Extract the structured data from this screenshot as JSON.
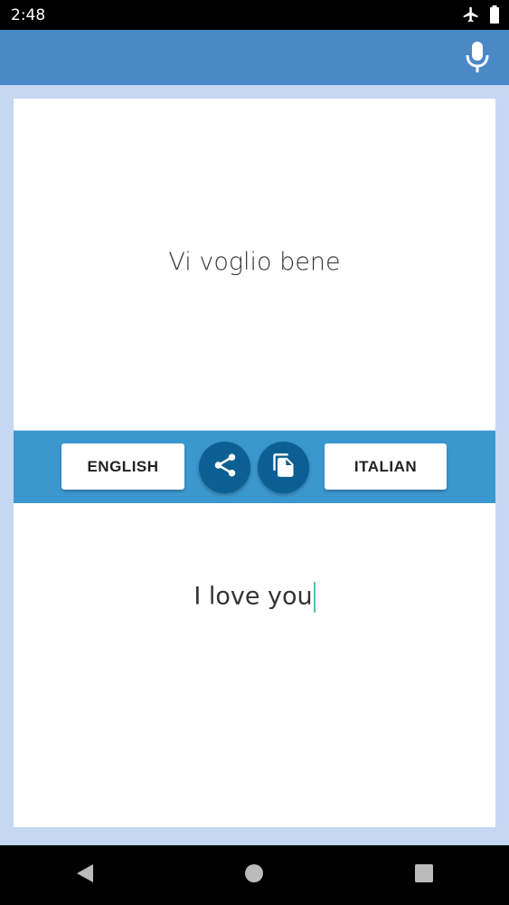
{
  "status_bar": {
    "time": "2:48",
    "icons": [
      "airplane-icon",
      "battery-icon"
    ]
  },
  "app_bar": {
    "mic_icon": "microphone-icon",
    "color": "#4b88c6"
  },
  "source": {
    "text": "Vi voglio bene"
  },
  "toolbar": {
    "source_language": "ENGLISH",
    "target_language": "ITALIAN",
    "share_icon": "share-icon",
    "copy_icon": "copy-icon",
    "color": "#3b98cf",
    "button_color": "#0c5f92"
  },
  "target": {
    "text": "I love you"
  },
  "nav_bar": {
    "icons": [
      "back-icon",
      "home-icon",
      "recents-icon"
    ]
  }
}
